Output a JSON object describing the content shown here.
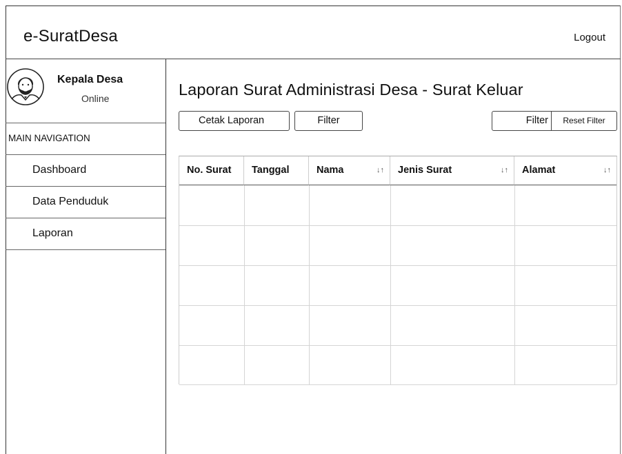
{
  "header": {
    "app_title": "e-SuratDesa",
    "logout_label": "Logout"
  },
  "sidebar": {
    "user": {
      "name": "Kepala Desa",
      "status": "Online"
    },
    "nav_heading": "MAIN NAVIGATION",
    "items": [
      {
        "label": "Dashboard"
      },
      {
        "label": "Data Penduduk"
      },
      {
        "label": "Laporan"
      }
    ]
  },
  "main": {
    "title": "Laporan Surat Administrasi Desa - Surat Keluar",
    "buttons": {
      "cetak": "Cetak Laporan",
      "filter_left": "Filter",
      "filter_right": "Filter",
      "reset": "Reset Filter"
    },
    "table": {
      "columns": [
        "No. Surat",
        "Tanggal",
        "Nama",
        "Jenis Surat",
        "Alamat"
      ],
      "sort_icon": "↓↑",
      "rows": [
        [],
        [],
        [],
        [],
        []
      ]
    }
  }
}
